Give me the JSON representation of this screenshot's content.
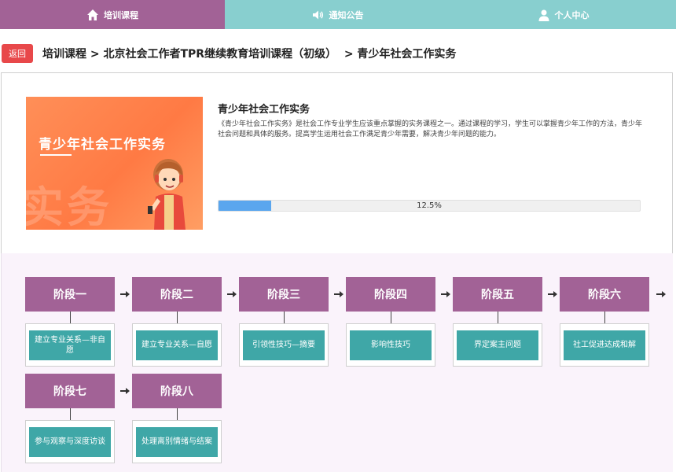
{
  "nav": {
    "tabs": [
      {
        "label": "培训课程",
        "icon": "home-icon"
      },
      {
        "label": "通知公告",
        "icon": "speaker-icon"
      },
      {
        "label": "个人中心",
        "icon": "user-icon"
      }
    ]
  },
  "breadcrumb": {
    "back_label": "返回",
    "text": "培训课程 > 北京社会工作者TPR继续教育培训课程（初级）  > 青少年社会工作实务"
  },
  "course": {
    "cover_title": "青少年社会工作实务",
    "cover_bg_text": "实务",
    "title": "青少年社会工作实务",
    "description": "《青少年社会工作实务》是社会工作专业学生应该重点掌握的实务课程之一。通过课程的学习，学生可以掌握青少年工作的方法，青少年社会问题和具体的服务。提高学生运用社会工作满足青少年需要，解决青少年问题的能力。",
    "progress_percent": 12.5,
    "progress_label": "12.5%"
  },
  "stages": [
    {
      "name": "阶段一",
      "lesson": "建立专业关系—非自愿"
    },
    {
      "name": "阶段二",
      "lesson": "建立专业关系—自愿"
    },
    {
      "name": "阶段三",
      "lesson": "引领性技巧—摘要"
    },
    {
      "name": "阶段四",
      "lesson": "影响性技巧"
    },
    {
      "name": "阶段五",
      "lesson": "界定案主问题"
    },
    {
      "name": "阶段六",
      "lesson": "社工促进达成和解"
    },
    {
      "name": "阶段七",
      "lesson": "参与观察与深度访谈"
    },
    {
      "name": "阶段八",
      "lesson": "处理离别情绪与结案"
    }
  ],
  "colors": {
    "nav_active": "#a26296",
    "nav_inactive": "#88cfcf",
    "stage_head": "#a26296",
    "lesson_button": "#3fa7a7",
    "back_button": "#e8484a",
    "progress_fill": "#5aa6ee"
  }
}
